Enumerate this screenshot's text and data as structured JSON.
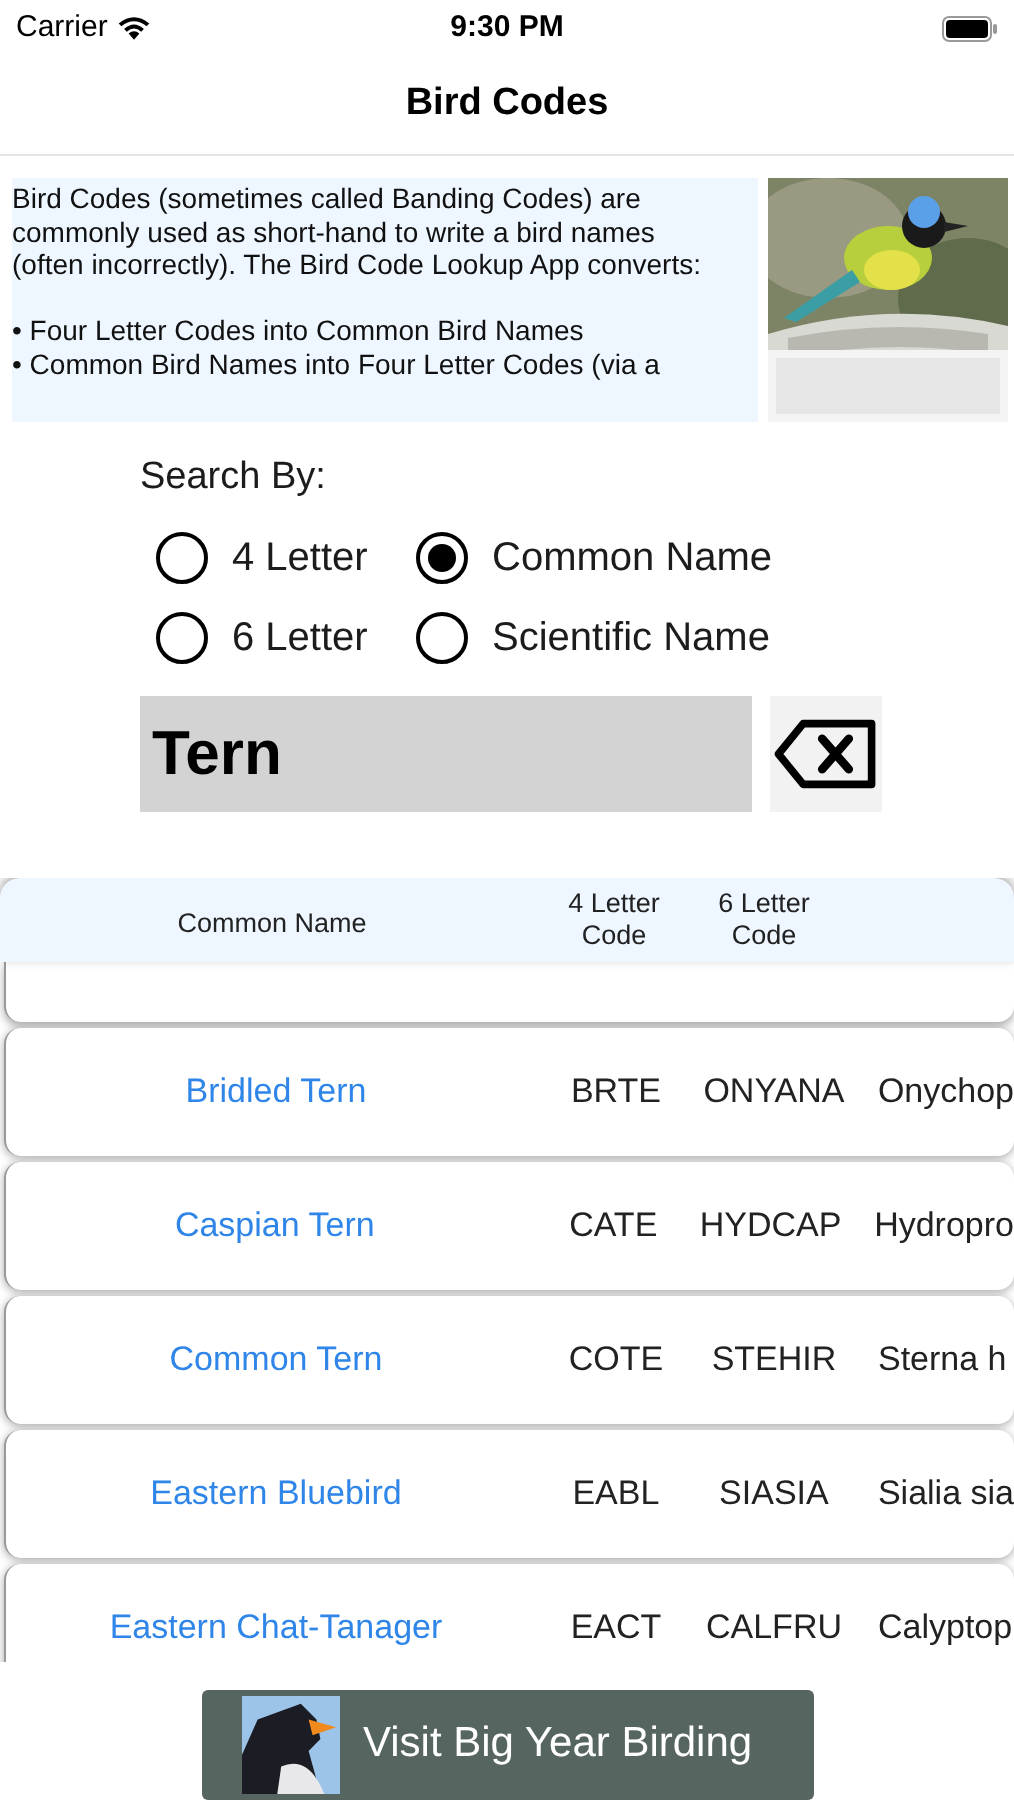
{
  "status_bar": {
    "carrier": "Carrier",
    "time": "9:30 PM"
  },
  "nav": {
    "title": "Bird Codes"
  },
  "intro": {
    "lines": [
      "Bird Codes (sometimes called Banding Codes) are commonly used as short-hand to write a bird names (often incorrectly). The Bird Code Lookup App converts:",
      "• Four Letter Codes into Common Bird Names",
      "• Common Bird Names into Four Letter Codes (via a"
    ],
    "image": {
      "kind": "picture"
    }
  },
  "search": {
    "label": "Search By:",
    "options": [
      {
        "label": "4 Letter",
        "selected": false
      },
      {
        "label": "Common Name",
        "selected": true
      },
      {
        "label": "6 Letter",
        "selected": false
      },
      {
        "label": "Scientific Name",
        "selected": false
      }
    ],
    "value": "Tern"
  },
  "table": {
    "columns": [
      "Common Name",
      "4 Letter Code",
      "6 Letter Code"
    ],
    "rows": [
      {
        "name": "Bridled Tern",
        "code4": "BRTE",
        "code6": "ONYANA",
        "scientific": "Onychop"
      },
      {
        "name": "Caspian Tern",
        "code4": "CATE",
        "code6": "HYDCAP",
        "scientific": "Hydropro"
      },
      {
        "name": "Common Tern",
        "code4": "COTE",
        "code6": "STEHIR",
        "scientific": "Sterna h"
      },
      {
        "name": "Eastern Bluebird",
        "code4": "EABL",
        "code6": "SIASIA",
        "scientific": "Sialia sia"
      },
      {
        "name": "Eastern Chat-Tanager",
        "code4": "EACT",
        "code6": "CALFRU",
        "scientific": "Calyptop"
      }
    ]
  },
  "footer_button": {
    "label": "Visit Big Year Birding"
  }
}
